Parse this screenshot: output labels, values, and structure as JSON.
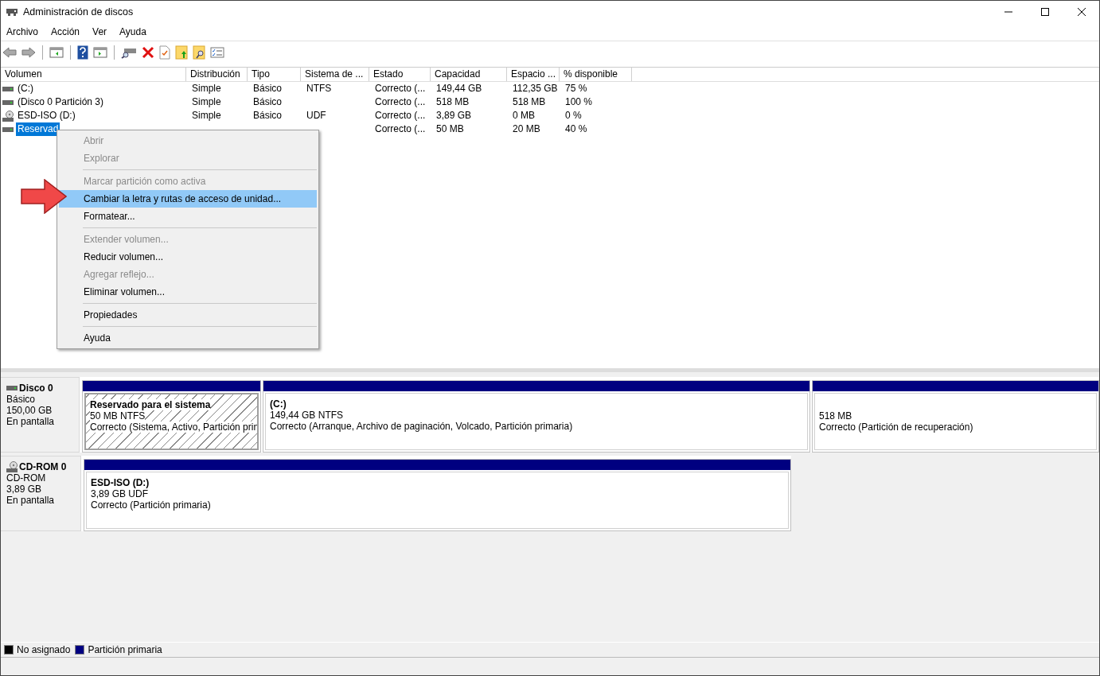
{
  "window": {
    "title": "Administración de discos"
  },
  "menu_bar": [
    "Archivo",
    "Acción",
    "Ver",
    "Ayuda"
  ],
  "volume_list": {
    "columns": [
      "Volumen",
      "Distribución",
      "Tipo",
      "Sistema de ...",
      "Estado",
      "Capacidad",
      "Espacio ...",
      "% disponible"
    ],
    "rows": [
      {
        "selected": false,
        "kind": "disk",
        "cells": [
          " (C:)",
          "Simple",
          "Básico",
          "NTFS",
          "Correcto (...",
          "149,44 GB",
          "112,35 GB",
          "75 %"
        ]
      },
      {
        "selected": false,
        "kind": "disk",
        "cells": [
          "(Disco 0 Partición 3)",
          "Simple",
          "Básico",
          "",
          "Correcto (...",
          "518 MB",
          "518 MB",
          "100 %"
        ]
      },
      {
        "selected": false,
        "kind": "cd",
        "cells": [
          "ESD-ISO (D:)",
          "Simple",
          "Básico",
          "UDF",
          "Correcto (...",
          "3,89 GB",
          "0 MB",
          "0 %"
        ]
      },
      {
        "selected": true,
        "kind": "disk",
        "cells": [
          "Reservad",
          "",
          "",
          "",
          "Correcto (...",
          "50 MB",
          "20 MB",
          "40 %"
        ]
      }
    ]
  },
  "context_menu": [
    {
      "kind": "item",
      "label": "Abrir",
      "disabled": true,
      "selected": false
    },
    {
      "kind": "item",
      "label": "Explorar",
      "disabled": true,
      "selected": false
    },
    {
      "kind": "separator"
    },
    {
      "kind": "item",
      "label": "Marcar partición como activa",
      "disabled": true,
      "selected": false
    },
    {
      "kind": "item",
      "label": "Cambiar la letra y rutas de acceso de unidad...",
      "disabled": false,
      "selected": true
    },
    {
      "kind": "item",
      "label": "Formatear...",
      "disabled": false,
      "selected": false
    },
    {
      "kind": "separator"
    },
    {
      "kind": "item",
      "label": "Extender volumen...",
      "disabled": true,
      "selected": false
    },
    {
      "kind": "item",
      "label": "Reducir volumen...",
      "disabled": false,
      "selected": false
    },
    {
      "kind": "item",
      "label": "Agregar reflejo...",
      "disabled": true,
      "selected": false
    },
    {
      "kind": "item",
      "label": "Eliminar volumen...",
      "disabled": false,
      "selected": false
    },
    {
      "kind": "separator"
    },
    {
      "kind": "item",
      "label": "Propiedades",
      "disabled": false,
      "selected": false
    },
    {
      "kind": "separator"
    },
    {
      "kind": "item",
      "label": "Ayuda",
      "disabled": false,
      "selected": false
    }
  ],
  "disks": [
    {
      "kind": "disk",
      "name": "Disco 0",
      "type": "Básico",
      "size": "150,00 GB",
      "status": "En pantalla",
      "partitions": [
        {
          "selected": true,
          "name": "Reservado para el sistema",
          "size": "50 MB NTFS",
          "status": "Correcto (Sistema, Activo, Partición prin"
        },
        {
          "selected": false,
          "name": " (C:)",
          "size": "149,44 GB NTFS",
          "status": "Correcto (Arranque, Archivo de paginación, Volcado, Partición primaria)"
        },
        {
          "selected": false,
          "size": "518 MB",
          "status": "Correcto (Partición de recuperación)"
        }
      ]
    },
    {
      "kind": "cd",
      "name": "CD-ROM 0",
      "type": "CD-ROM",
      "size": "3,89 GB",
      "status": "En pantalla",
      "partitions": [
        {
          "selected": false,
          "name": "ESD-ISO  (D:)",
          "size": "3,89 GB UDF",
          "status": "Correcto (Partición primaria)"
        }
      ]
    }
  ],
  "legend": [
    {
      "label": "No asignado",
      "color": "#000000"
    },
    {
      "label": "Partición primaria",
      "color": "#000080"
    }
  ]
}
